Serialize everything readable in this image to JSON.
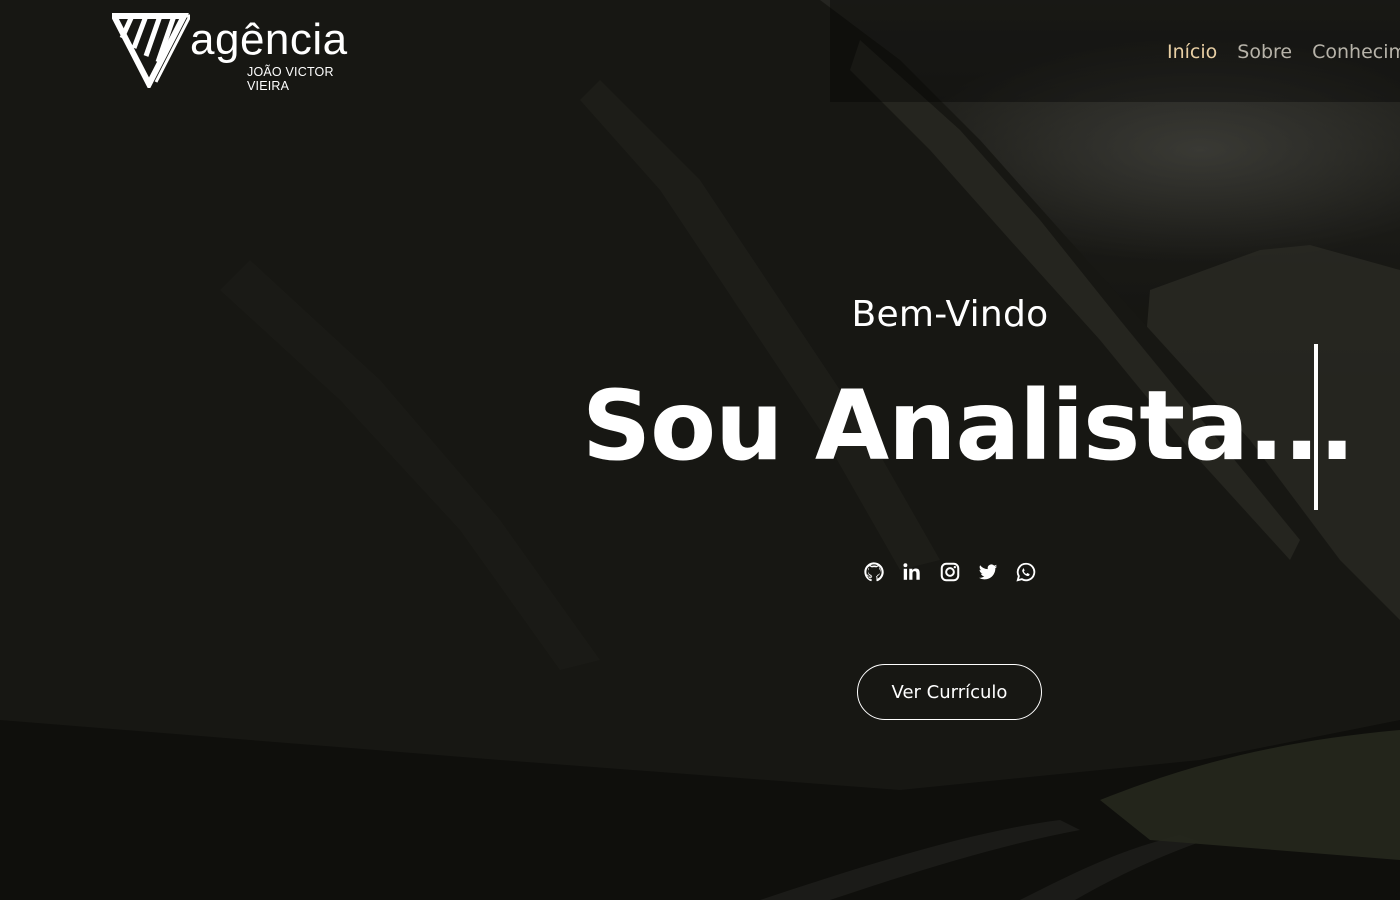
{
  "brand": {
    "wordmark": "agência",
    "owner": "JOÃO VICTOR VIEIRA",
    "logo_icon": "triangle-v-logo-icon"
  },
  "nav": {
    "items": [
      {
        "label": "Início",
        "active": true
      },
      {
        "label": "Sobre",
        "active": false
      },
      {
        "label": "Conhecim",
        "active": false
      }
    ],
    "active_color": "#e8cfa4",
    "inactive_color": "#b7b3a9"
  },
  "hero": {
    "greeting": "Bem-Vindo",
    "title": "Sou Analista...",
    "cta_label": "Ver Currículo"
  },
  "socials": [
    {
      "icon": "github-icon"
    },
    {
      "icon": "linkedin-icon"
    },
    {
      "icon": "instagram-icon"
    },
    {
      "icon": "twitter-icon"
    },
    {
      "icon": "whatsapp-icon"
    }
  ]
}
